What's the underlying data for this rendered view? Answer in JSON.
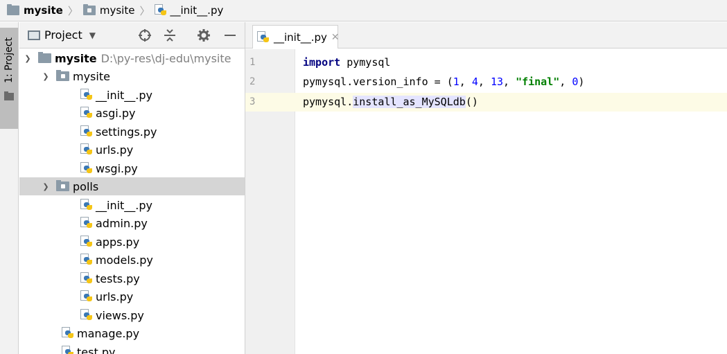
{
  "breadcrumb": {
    "items": [
      {
        "label": "mysite",
        "icon": "folder-icon"
      },
      {
        "label": "mysite",
        "icon": "package-folder-icon"
      },
      {
        "label": "__init__.py",
        "icon": "python-file-icon"
      }
    ]
  },
  "side_strip": {
    "tab_label": "1: Project"
  },
  "project_panel": {
    "title": "Project",
    "tools": [
      "locate-icon",
      "collapse-all-icon",
      "gear-icon",
      "hide-icon"
    ]
  },
  "tree": {
    "root": {
      "label": "mysite",
      "path": "D:\\py-res\\dj-edu\\mysite"
    },
    "mysite_pkg": {
      "label": "mysite",
      "files": [
        "__init__.py",
        "asgi.py",
        "settings.py",
        "urls.py",
        "wsgi.py"
      ]
    },
    "polls_pkg": {
      "label": "polls",
      "files": [
        "__init__.py",
        "admin.py",
        "apps.py",
        "models.py",
        "tests.py",
        "urls.py",
        "views.py"
      ]
    },
    "root_files": [
      "manage.py",
      "test.py"
    ]
  },
  "editor": {
    "tab_label": "__init__.py",
    "line_numbers": [
      "1",
      "2",
      "3"
    ],
    "code": {
      "line1": {
        "keyword": "import",
        "rest": " pymysql"
      },
      "line2": {
        "prefix": "pymysql.version_info = (",
        "n1": "1",
        "n2": "4",
        "n3": "13",
        "str": "\"final\"",
        "n4": "0",
        "suffix": ")"
      },
      "line3": {
        "prefix": "pymysql.",
        "highlight": "install_as_MySQLdb",
        "suffix": "()"
      }
    }
  },
  "colors": {
    "keyword": "#000080",
    "number": "#0000ff",
    "string": "#008000",
    "caret_row": "#fdfbe6",
    "selection": "#d5d5d5"
  }
}
